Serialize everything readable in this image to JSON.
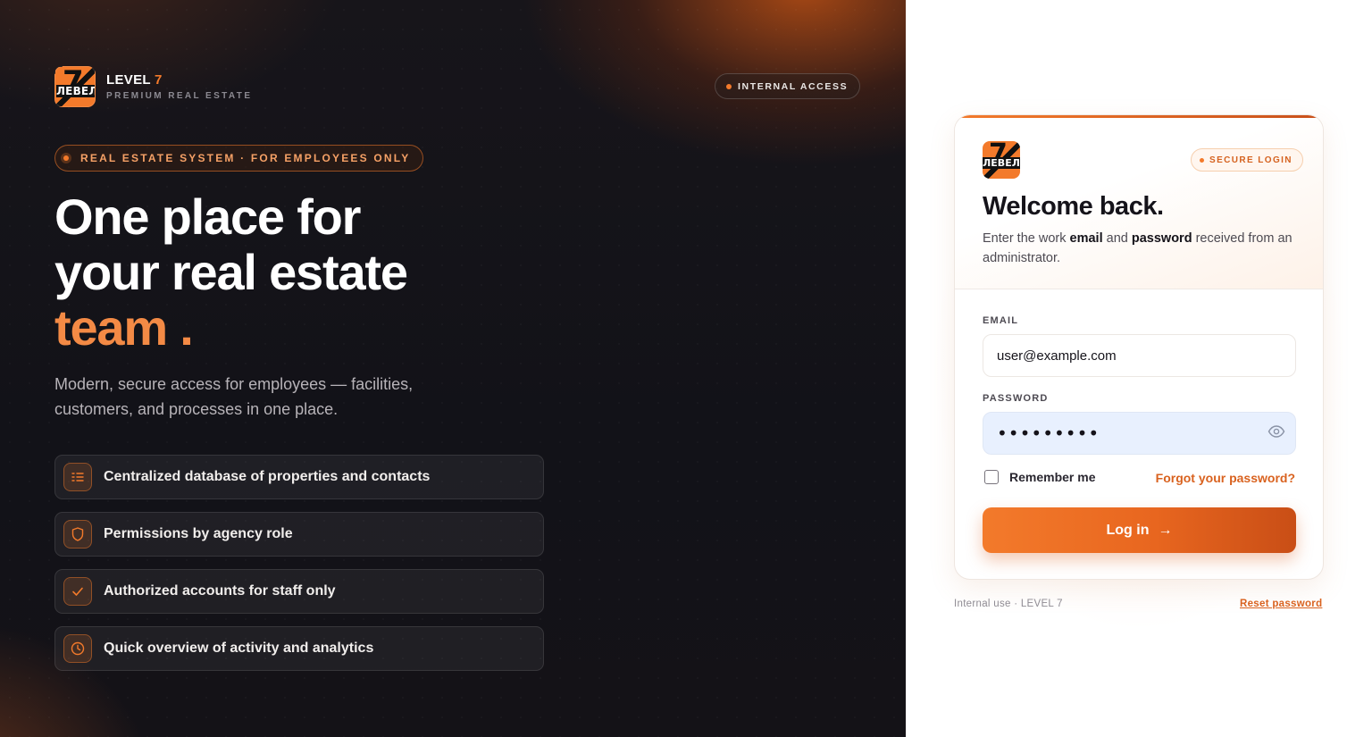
{
  "brand": {
    "logo_number": "7",
    "logo_text": "ЛЕВЕЛ",
    "name_prefix": "LEVEL",
    "name_number": "7",
    "tagline": "PREMIUM REAL ESTATE"
  },
  "badges": {
    "internal_access": "INTERNAL ACCESS",
    "system": "REAL ESTATE SYSTEM · FOR EMPLOYEES ONLY"
  },
  "hero": {
    "line1": "One place for",
    "line2": "your real estate",
    "line3_accent": "team .",
    "description": "Modern, secure access for employees — facilities, customers, and processes in one place."
  },
  "features": [
    {
      "icon": "list-icon",
      "label": "Centralized database of properties and contacts"
    },
    {
      "icon": "shield-icon",
      "label": "Permissions by agency role"
    },
    {
      "icon": "check-icon",
      "label": "Authorized accounts for staff only"
    },
    {
      "icon": "clock-icon",
      "label": "Quick overview of activity and analytics"
    }
  ],
  "login": {
    "secure_badge": "SECURE LOGIN",
    "title": "Welcome back.",
    "instr_pre": "Enter the work ",
    "instr_email": "email",
    "instr_and": " and ",
    "instr_password": "password",
    "instr_post": " received from an administrator.",
    "email_label": "EMAIL",
    "email_value": "user@example.com",
    "password_label": "PASSWORD",
    "password_value": "•••••••••",
    "remember_label": "Remember me",
    "forgot_label": "Forgot your password?",
    "button_label": "Log in",
    "button_arrow": "→"
  },
  "footer": {
    "left": "Internal use · LEVEL 7",
    "right": "Reset password"
  },
  "colors": {
    "accent": "#f37a2b",
    "accent_dark": "#c94e16",
    "dark_bg": "#141217"
  }
}
